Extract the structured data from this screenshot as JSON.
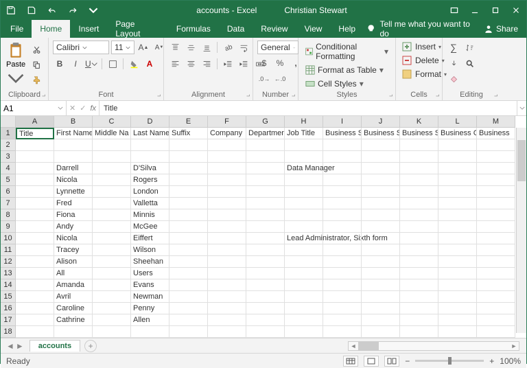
{
  "titlebar": {
    "title": "accounts - Excel",
    "user": "Christian Stewart"
  },
  "menu": {
    "tabs": [
      "File",
      "Home",
      "Insert",
      "Page Layout",
      "Formulas",
      "Data",
      "Review",
      "View",
      "Help"
    ],
    "active": 1,
    "tell": "Tell me what you want to do",
    "share": "Share"
  },
  "ribbon": {
    "clipboard": {
      "label": "Clipboard",
      "paste": "Paste"
    },
    "font": {
      "label": "Font",
      "name": "Calibri",
      "size": "11"
    },
    "alignment": {
      "label": "Alignment"
    },
    "number": {
      "label": "Number",
      "format": "General"
    },
    "styles": {
      "label": "Styles",
      "cond": "Conditional Formatting",
      "table": "Format as Table",
      "cell": "Cell Styles"
    },
    "cells": {
      "label": "Cells",
      "insert": "Insert",
      "delete": "Delete",
      "format": "Format"
    },
    "editing": {
      "label": "Editing"
    }
  },
  "namebox": "A1",
  "formula": "Title",
  "columns": [
    "A",
    "B",
    "C",
    "D",
    "E",
    "F",
    "G",
    "H",
    "I",
    "J",
    "K",
    "L",
    "M"
  ],
  "rows": [
    1,
    2,
    3,
    4,
    5,
    6,
    7,
    8,
    9,
    10,
    11,
    12,
    13,
    14,
    15,
    16,
    17,
    18
  ],
  "headers": [
    "Title",
    "First Name",
    "Middle Na",
    "Last Name",
    "Suffix",
    "Company",
    "Departmen",
    "Job Title",
    "Business S",
    "Business S",
    "Business S",
    "Business C",
    "Business"
  ],
  "data": {
    "4": {
      "B": "Darrell",
      "D": "D'Silva",
      "H": "Data Manager"
    },
    "5": {
      "B": "Nicola",
      "D": "Rogers"
    },
    "6": {
      "B": "Lynnette",
      "D": "London"
    },
    "7": {
      "B": "Fred",
      "D": "Valletta"
    },
    "8": {
      "B": "Fiona",
      "D": "Minnis"
    },
    "9": {
      "B": "Andy",
      "D": "McGee"
    },
    "10": {
      "B": "Nicola",
      "D": "Eiffert",
      "H": "Lead Administrator, Sixth form"
    },
    "11": {
      "B": "Tracey",
      "D": "Wilson"
    },
    "12": {
      "B": "Alison",
      "D": "Sheehan"
    },
    "13": {
      "B": "All",
      "D": "Users"
    },
    "14": {
      "B": "Amanda",
      "D": "Evans"
    },
    "15": {
      "B": "Avril",
      "D": "Newman"
    },
    "16": {
      "B": "Caroline",
      "D": "Penny"
    },
    "17": {
      "B": "Cathrine",
      "D": "Allen"
    }
  },
  "sheet": {
    "name": "accounts"
  },
  "status": {
    "ready": "Ready",
    "zoom": "100%"
  }
}
